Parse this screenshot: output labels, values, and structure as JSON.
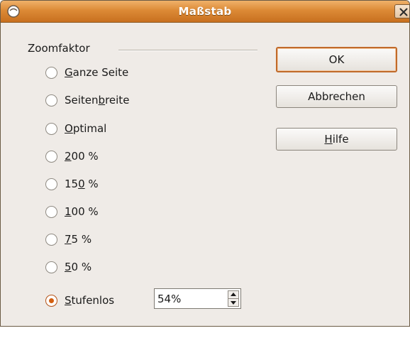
{
  "window": {
    "title": "Maßstab",
    "icons": {
      "app": "app-icon",
      "close": "close-icon"
    }
  },
  "zoom_group": {
    "title": "Zoomfaktor",
    "options": [
      {
        "label_before": "",
        "label_key": "G",
        "label_after": "anze Seite",
        "checked": false
      },
      {
        "label_before": "Seiten",
        "label_key": "b",
        "label_after": "reite",
        "checked": false
      },
      {
        "label_before": "",
        "label_key": "O",
        "label_after": "ptimal",
        "checked": false
      },
      {
        "label_before": "",
        "label_key": "2",
        "label_after": "00 %",
        "checked": false
      },
      {
        "label_before": "15",
        "label_key": "0",
        "label_after": " %",
        "checked": false
      },
      {
        "label_before": "",
        "label_key": "1",
        "label_after": "00 %",
        "checked": false
      },
      {
        "label_before": "",
        "label_key": "7",
        "label_after": "5 %",
        "checked": false
      },
      {
        "label_before": "",
        "label_key": "5",
        "label_after": "0 %",
        "checked": false
      },
      {
        "label_before": "",
        "label_key": "S",
        "label_after": "tufenlos",
        "checked": true
      }
    ],
    "custom_value": "54%"
  },
  "buttons": {
    "ok": "OK",
    "cancel": "Abbrechen",
    "help_key": "H",
    "help_rest": "ilfe"
  },
  "colors": {
    "titlebar": "#dc8a36",
    "accent": "#d35f0f",
    "dialog_bg": "#efebe7"
  }
}
